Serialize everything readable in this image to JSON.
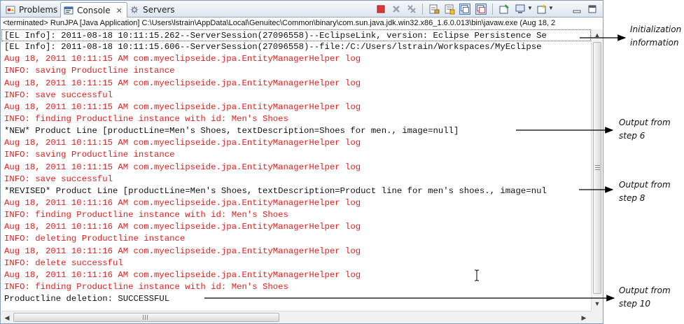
{
  "tabs": [
    {
      "label": "Problems",
      "icon": "problems-icon"
    },
    {
      "label": "Console",
      "icon": "console-icon",
      "close": "✕"
    },
    {
      "label": "Servers",
      "icon": "servers-icon"
    }
  ],
  "toolbar": {
    "icons": [
      "terminate-icon",
      "remove-launch-icon",
      "remove-all-launches-icon",
      "clear-console-icon",
      "scroll-lock-icon",
      "show-on-stdout-icon",
      "show-on-stderr-icon",
      "pin-console-icon",
      "display-console-icon",
      "open-console-icon",
      "minimize-icon",
      "maximize-icon"
    ]
  },
  "path_line": "<terminated> RunJPA [Java Application] C:\\Users\\lstrain\\AppData\\Local\\Genuitec\\Common\\binary\\com.sun.java.jdk.win32.x86_1.6.0.013\\bin\\javaw.exe (Aug 18, 2",
  "console_lines": [
    {
      "text": "[EL Info]: 2011-08-18 10:11:15.262--ServerSession(27096558)--EclipseLink, version: Eclipse Persistence Se",
      "color": "black"
    },
    {
      "text": "[EL Info]: 2011-08-18 10:11:15.606--ServerSession(27096558)--file:/C:/Users/lstrain/Workspaces/MyEclipse",
      "color": "black"
    },
    {
      "text": "Aug 18, 2011 10:11:15 AM com.myeclipseide.jpa.EntityManagerHelper log",
      "color": "red"
    },
    {
      "text": "INFO: saving Productline instance",
      "color": "red"
    },
    {
      "text": "Aug 18, 2011 10:11:15 AM com.myeclipseide.jpa.EntityManagerHelper log",
      "color": "red"
    },
    {
      "text": "INFO: save successful",
      "color": "red"
    },
    {
      "text": "Aug 18, 2011 10:11:15 AM com.myeclipseide.jpa.EntityManagerHelper log",
      "color": "red"
    },
    {
      "text": "INFO: finding Productline instance with id: Men's Shoes",
      "color": "red"
    },
    {
      "text": "*NEW* Product Line [productLine=Men's Shoes, textDescription=Shoes for men., image=null]",
      "color": "black"
    },
    {
      "text": "Aug 18, 2011 10:11:15 AM com.myeclipseide.jpa.EntityManagerHelper log",
      "color": "red"
    },
    {
      "text": "INFO: saving Productline instance",
      "color": "red"
    },
    {
      "text": "Aug 18, 2011 10:11:15 AM com.myeclipseide.jpa.EntityManagerHelper log",
      "color": "red"
    },
    {
      "text": "INFO: save successful",
      "color": "red"
    },
    {
      "text": "*REVISED* Product Line [productLine=Men's Shoes, textDescription=Product line for men's shoes., image=nul",
      "color": "black"
    },
    {
      "text": "Aug 18, 2011 10:11:16 AM com.myeclipseide.jpa.EntityManagerHelper log",
      "color": "red"
    },
    {
      "text": "INFO: finding Productline instance with id: Men's Shoes",
      "color": "red"
    },
    {
      "text": "Aug 18, 2011 10:11:16 AM com.myeclipseide.jpa.EntityManagerHelper log",
      "color": "red"
    },
    {
      "text": "INFO: deleting Productline instance",
      "color": "red"
    },
    {
      "text": "Aug 18, 2011 10:11:16 AM com.myeclipseide.jpa.EntityManagerHelper log",
      "color": "red"
    },
    {
      "text": "INFO: delete successful",
      "color": "red"
    },
    {
      "text": "Aug 18, 2011 10:11:16 AM com.myeclipseide.jpa.EntityManagerHelper log",
      "color": "red"
    },
    {
      "text": "INFO: finding Productline instance with id: Men's Shoes",
      "color": "red"
    },
    {
      "text": "Productline deletion: SUCCESSFUL",
      "color": "black"
    }
  ],
  "annotations": [
    {
      "line1": "Initialization",
      "line2": "information"
    },
    {
      "line1": "Output from",
      "line2": "step 6"
    },
    {
      "line1": "Output from",
      "line2": "step 8"
    },
    {
      "line1": "Output from",
      "line2": "step 10"
    }
  ],
  "colors": {
    "stderr": "#e02020",
    "stdout": "#111111",
    "frame": "#8a9cb5"
  }
}
